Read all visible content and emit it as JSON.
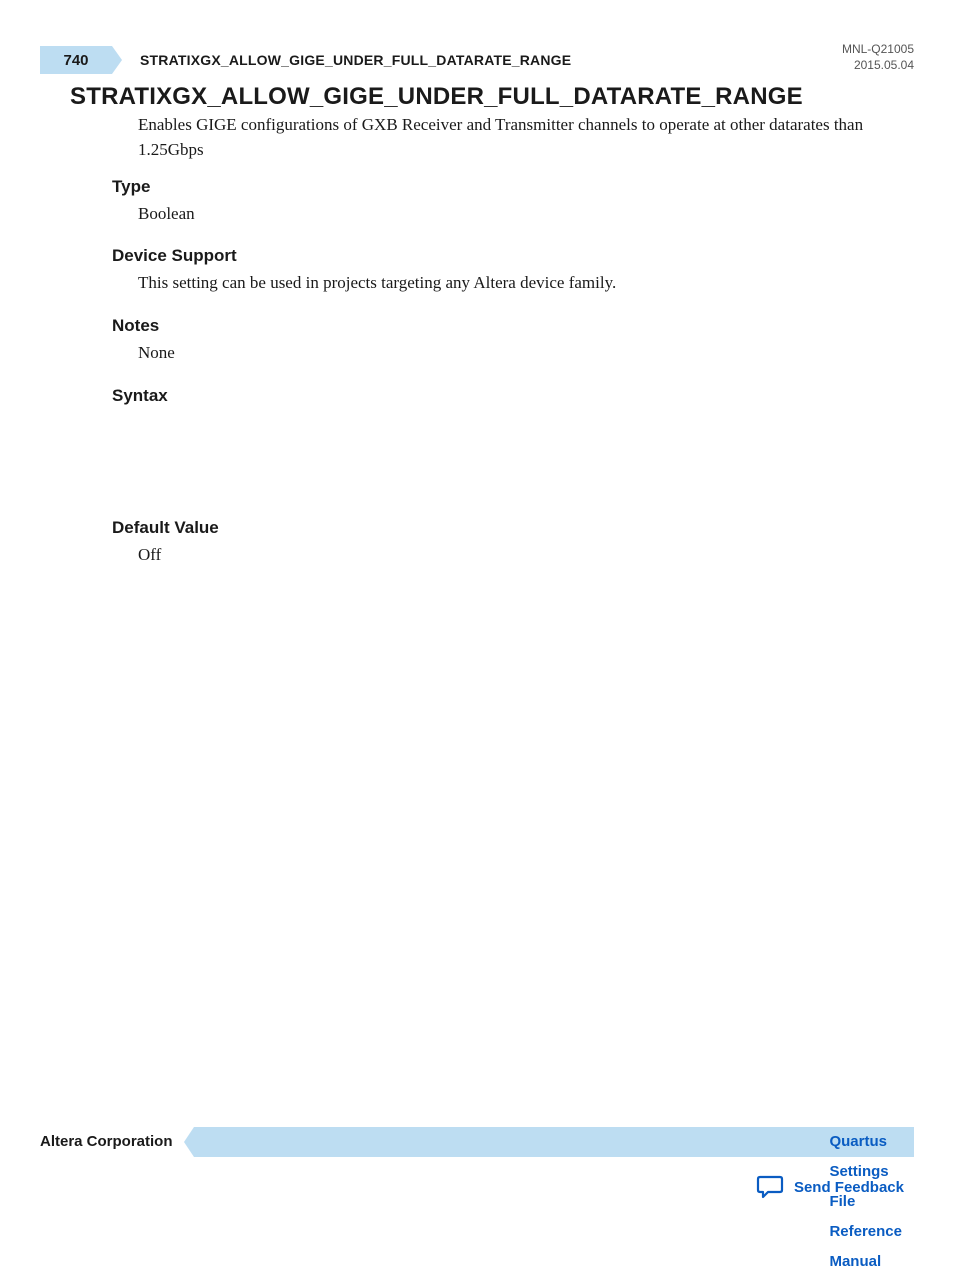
{
  "header": {
    "page_number": "740",
    "running_title": "STRATIXGX_ALLOW_GIGE_UNDER_FULL_DATARATE_RANGE",
    "doc_id": "MNL-Q21005",
    "doc_date": "2015.05.04"
  },
  "main": {
    "title": "STRATIXGX_ALLOW_GIGE_UNDER_FULL_DATARATE_RANGE",
    "description": "Enables GIGE configurations of GXB Receiver and Transmitter channels to operate at other datarates than 1.25Gbps"
  },
  "sections": {
    "type_label": "Type",
    "type_value": "Boolean",
    "device_support_label": "Device Support",
    "device_support_value": "This setting can be used in projects targeting any Altera device family.",
    "notes_label": "Notes",
    "notes_value": "None",
    "syntax_label": "Syntax",
    "default_value_label": "Default Value",
    "default_value_value": "Off"
  },
  "footer": {
    "company": "Altera Corporation",
    "manual_title": "Quartus Settings File Reference Manual",
    "feedback_label": "Send Feedback"
  }
}
